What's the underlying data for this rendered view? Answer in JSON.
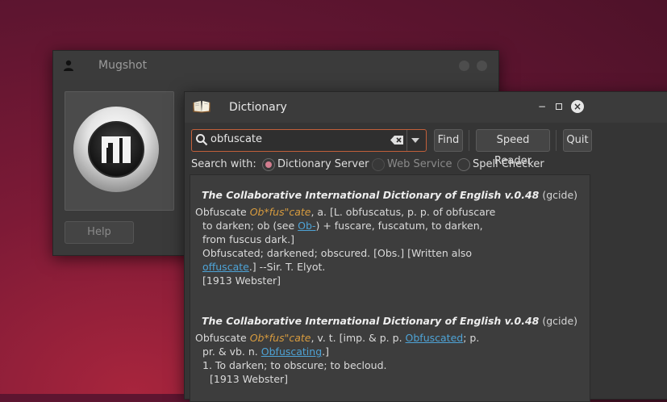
{
  "mugshot": {
    "title": "Mugshot",
    "help_label": "Help"
  },
  "dictionary": {
    "title": "Dictionary",
    "search": {
      "value": "obfuscate"
    },
    "buttons": {
      "find": "Find",
      "speed_reader": "Speed Reader",
      "quit": "Quit"
    },
    "search_with": {
      "label": "Search with:",
      "options": [
        {
          "label": "Dictionary Server",
          "selected": true,
          "enabled": true
        },
        {
          "label": "Web Service",
          "selected": false,
          "enabled": false
        },
        {
          "label": "Spell Checker",
          "selected": false,
          "enabled": true
        }
      ]
    },
    "entries": [
      {
        "source": "The Collaborative International Dictionary of English v.0.48",
        "tag": "(gcide)",
        "headword": "Obfuscate",
        "pron": "Ob*fus\"cate",
        "l1_rest": ", a. [L. obfuscatus, p. p. of obfuscare",
        "l2_a": "to darken; ob (see",
        "l2_link": "Ob-",
        "l2_b": ") + fuscare, fuscatum, to darken,",
        "l3": "from fuscus dark.]",
        "l4": "Obfuscated; darkened; obscured. [Obs.] [Written also",
        "l5_link": "offuscate",
        "l5_b": ".] --Sir. T. Elyot.",
        "l6": "[1913 Webster]"
      },
      {
        "source": "The Collaborative International Dictionary of English v.0.48",
        "tag": "(gcide)",
        "headword": "Obfuscate",
        "pron": "Ob*fus\"cate",
        "l1_a": ", v. t. [imp. & p. p.",
        "l1_link": "Obfuscated",
        "l1_b": "; p.",
        "l2_a": "pr. & vb. n.",
        "l2_link": "Obfuscating",
        "l2_b": ".]",
        "l3": "1. To darken; to obscure; to becloud.",
        "l4": "[1913 Webster]"
      }
    ]
  },
  "colors": {
    "accent": "#c2603a",
    "link": "#4ea3d6",
    "pronunciation": "#d79b3e",
    "radio_selected": "#d27d8f"
  }
}
